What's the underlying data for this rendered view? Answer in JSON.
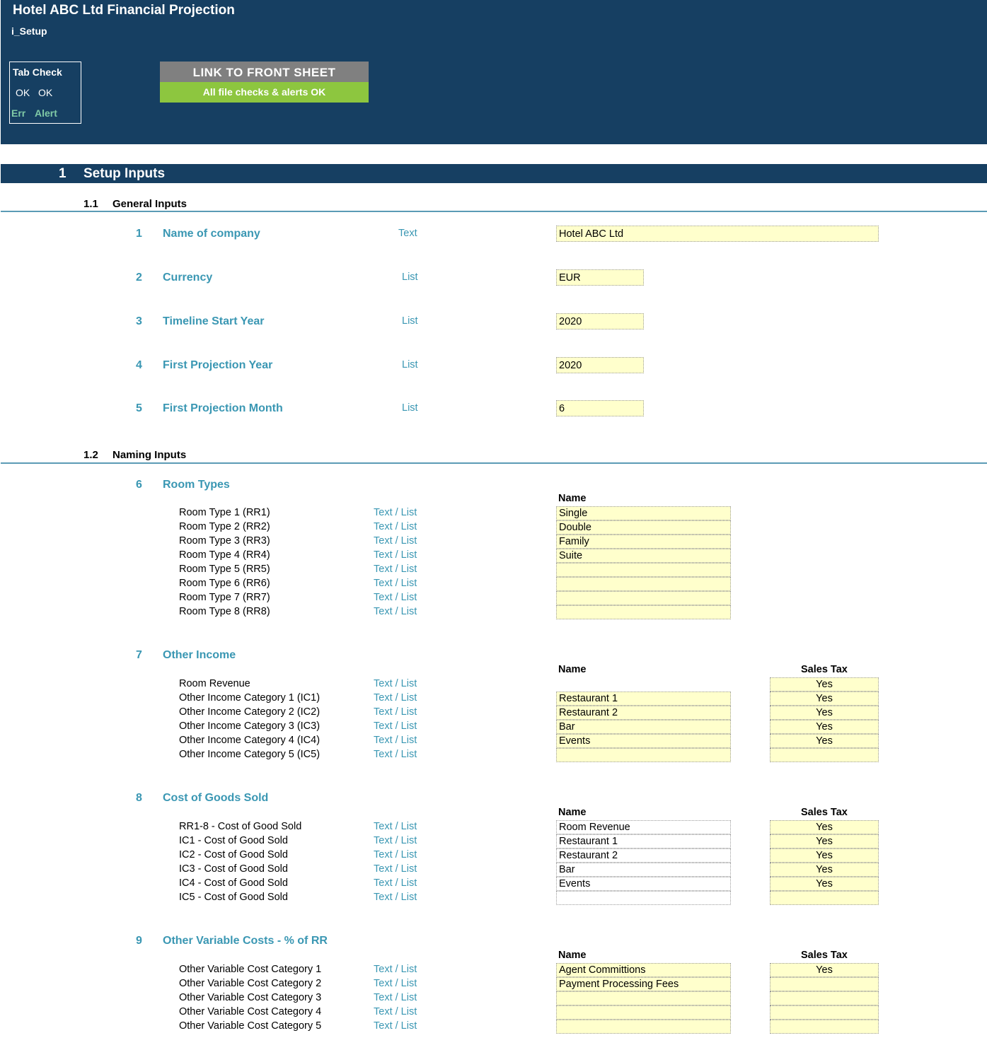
{
  "header": {
    "title": "Hotel ABC Ltd Financial Projection",
    "sheet": "i_Setup",
    "tab_check": {
      "title": "Tab Check",
      "ok1": "OK",
      "ok2": "OK",
      "err": "Err",
      "alert": "Alert"
    },
    "link_button": "LINK TO FRONT SHEET",
    "status": "All file checks & alerts OK",
    "colors": {
      "header_bg": "#163f62",
      "ok_green": "#8dc63f",
      "accent": "#3a97b3",
      "input_bg": "#ffffcc"
    }
  },
  "section": {
    "number": "1",
    "title": "Setup Inputs"
  },
  "general": {
    "number": "1.1",
    "title": "General Inputs",
    "items": [
      {
        "num": "1",
        "label": "Name of company",
        "type": "Text",
        "value": "Hotel ABC Ltd"
      },
      {
        "num": "2",
        "label": "Currency",
        "type": "List",
        "value": "EUR"
      },
      {
        "num": "3",
        "label": "Timeline Start Year",
        "type": "List",
        "value": "2020"
      },
      {
        "num": "4",
        "label": "First Projection Year",
        "type": "List",
        "value": "2020"
      },
      {
        "num": "5",
        "label": "First Projection Month",
        "type": "List",
        "value": "6"
      }
    ]
  },
  "naming": {
    "number": "1.2",
    "title": "Naming Inputs",
    "col_name": "Name",
    "col_tax": "Sales Tax",
    "groups": [
      {
        "num": "6",
        "title": "Room Types",
        "rows": [
          {
            "label": "Room Type 1 (RR1)",
            "type": "Text / List",
            "name": "Single"
          },
          {
            "label": "Room Type 2 (RR2)",
            "type": "Text / List",
            "name": "Double"
          },
          {
            "label": "Room Type 3 (RR3)",
            "type": "Text / List",
            "name": "Family"
          },
          {
            "label": "Room Type 4 (RR4)",
            "type": "Text / List",
            "name": "Suite"
          },
          {
            "label": "Room Type 5 (RR5)",
            "type": "Text / List",
            "name": ""
          },
          {
            "label": "Room Type 6 (RR6)",
            "type": "Text / List",
            "name": ""
          },
          {
            "label": "Room Type 7 (RR7)",
            "type": "Text / List",
            "name": ""
          },
          {
            "label": "Room Type 8 (RR8)",
            "type": "Text / List",
            "name": ""
          }
        ]
      },
      {
        "num": "7",
        "title": "Other Income",
        "rows": [
          {
            "label": "Room Revenue",
            "type": "Text / List",
            "name": null,
            "tax": "Yes"
          },
          {
            "label": "Other Income Category 1 (IC1)",
            "type": "Text / List",
            "name": "Restaurant 1",
            "tax": "Yes"
          },
          {
            "label": "Other Income Category 2 (IC2)",
            "type": "Text / List",
            "name": "Restaurant 2",
            "tax": "Yes"
          },
          {
            "label": "Other Income Category 3 (IC3)",
            "type": "Text / List",
            "name": "Bar",
            "tax": "Yes"
          },
          {
            "label": "Other Income Category 4 (IC4)",
            "type": "Text / List",
            "name": "Events",
            "tax": "Yes"
          },
          {
            "label": "Other Income Category 5 (IC5)",
            "type": "Text / List",
            "name": "",
            "tax": ""
          }
        ]
      },
      {
        "num": "8",
        "title": "Cost of Goods Sold",
        "rows": [
          {
            "label": "RR1-8 - Cost of Good Sold",
            "type": "Text / List",
            "name": "Room Revenue",
            "tax": "Yes"
          },
          {
            "label": "IC1 - Cost of Good Sold",
            "type": "Text / List",
            "name": "Restaurant 1",
            "tax": "Yes"
          },
          {
            "label": "IC2 - Cost of Good Sold",
            "type": "Text / List",
            "name": "Restaurant 2",
            "tax": "Yes"
          },
          {
            "label": "IC3 - Cost of Good Sold",
            "type": "Text / List",
            "name": "Bar",
            "tax": "Yes"
          },
          {
            "label": "IC4 - Cost of Good Sold",
            "type": "Text / List",
            "name": "Events",
            "tax": "Yes"
          },
          {
            "label": "IC5 - Cost of Good Sold",
            "type": "Text / List",
            "name": "",
            "tax": ""
          }
        ]
      },
      {
        "num": "9",
        "title": "Other Variable Costs - % of RR",
        "rows": [
          {
            "label": "Other Variable Cost Category 1",
            "type": "Text / List",
            "name": "Agent Committions",
            "tax": "Yes"
          },
          {
            "label": "Other Variable Cost Category 2",
            "type": "Text / List",
            "name": "Payment Processing Fees",
            "tax": ""
          },
          {
            "label": "Other Variable Cost Category 3",
            "type": "Text / List",
            "name": "",
            "tax": ""
          },
          {
            "label": "Other Variable Cost Category 4",
            "type": "Text / List",
            "name": "",
            "tax": ""
          },
          {
            "label": "Other Variable Cost Category 5",
            "type": "Text / List",
            "name": "",
            "tax": ""
          }
        ]
      }
    ]
  }
}
